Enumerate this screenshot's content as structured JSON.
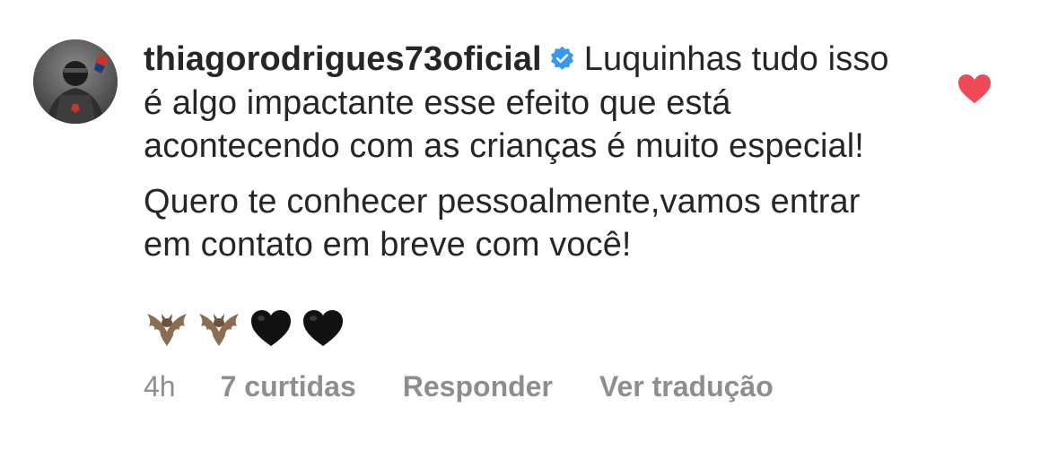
{
  "comment": {
    "username": "thiagorodrigues73oficial",
    "verified_icon": "verified-badge-icon",
    "paragraph1": "Luquinhas tudo isso é algo impactante esse efeito que está acontecendo com as crianças é muito especial!",
    "paragraph2": "Quero te conhecer pessoalmente,vamos entrar em contato em breve com você!",
    "emojis": [
      "bat-emoji",
      "bat-emoji",
      "black-heart-emoji",
      "black-heart-emoji"
    ],
    "time": "4h",
    "likes": "7 curtidas",
    "reply_label": "Responder",
    "translate_label": "Ver tradução",
    "liked": true,
    "like_color": "#ed4956",
    "verified_color": "#3897f0"
  }
}
